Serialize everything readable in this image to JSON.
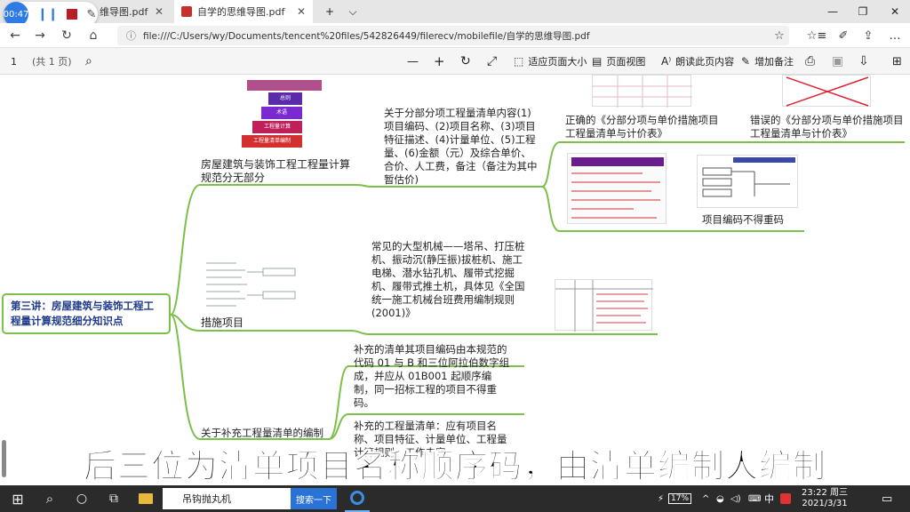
{
  "recorder": {
    "time": "00:47",
    "pause": "❙❙",
    "pen": "✎"
  },
  "tabs": [
    {
      "label": "维导图.pdf",
      "close": "✕"
    },
    {
      "label": "自学的思维导图.pdf",
      "close": "✕"
    }
  ],
  "window": {
    "new_tab": "+",
    "tab_menu": "⌵",
    "minimize": "—",
    "restore": "❐",
    "close": "✕"
  },
  "nav": {
    "back": "←",
    "forward": "→",
    "refresh": "↻",
    "home": "⌂"
  },
  "url": "file:///C:/Users/wy/Documents/tencent%20files/542826449/filerecv/mobilefile/自学的思维导图.pdf",
  "url_info": "ⓘ",
  "right_icons": {
    "favorite": "☆",
    "favorites_bar": "☆≡",
    "notes": "✐",
    "share": "⇪",
    "more": "…"
  },
  "pdf_toolbar": {
    "page_num": "1",
    "page_total": "(共 1 页)",
    "search": "⌕",
    "zoom_out": "—",
    "zoom_in": "+",
    "rotate": "↻",
    "fit": "⤢",
    "fit_page_label": "适应页面大小",
    "page_view_label": "页面视图",
    "read_aloud_label": "朗读此页内容",
    "add_note_label": "增加备注",
    "print": "⎙",
    "save": "▣",
    "save_as": "⇩",
    "pin": "⊞"
  },
  "mindmap": {
    "root": "第三讲：房屋建筑与装饰工程工程量计算规范细分知识点",
    "branch1": "房屋建筑与装饰工程工程量计算规范分无部分",
    "b1_detail": "关于分部分项工程量清单内容(1)项目编码、(2)项目名称、(3)项目特征描述、(4)计量单位、(5)工程量、(6)金额（元）及综合单价、合价、人工费，备注（备注为其中暂估价)",
    "b1_correct": "正确的《分部分项与单价措施项目工程量清单与计价表》",
    "b1_wrong": "错误的《分部分项与单价措施项目工程量清单与计价表》",
    "b1_code": "项目编码不得重码",
    "branch2": "措施项目",
    "b2_detail": "常见的大型机械——塔吊、打压桩机、振动沉(静压振)拔桩机、施工电梯、潜水钻孔机、履带式挖掘机、履带式推土机，具体见《全国统一施工机械台班费用编制规则(2001)》",
    "branch3": "关于补充工程量清单的编制",
    "b3_detail1": "补充的清单其项目编码由本规范的代码 01 与 B 和三位阿拉伯数字组成，并应从 01B001 起顺序编制，同一招标工程的项目不得重码。",
    "b3_detail2": "补充的工程量清单：应有项目名称、项目特征、计量单位、工程量计算规则、工作内容",
    "pyramid": [
      "总则",
      "术语",
      "工程量计算",
      "工程量清单编制"
    ]
  },
  "subtitle": "后三位为清单项目名称顺序码，由清单编制人编制",
  "taskbar": {
    "start": "⊞",
    "search_icon": "⌕",
    "cortana": "○",
    "taskview": "⧉",
    "search_query": "吊钩抛丸机",
    "search_button": "搜索一下",
    "battery": "17%",
    "ime": "中",
    "clock_time": "23:22 周三",
    "clock_date": "2021/3/31",
    "notify": "▭"
  }
}
